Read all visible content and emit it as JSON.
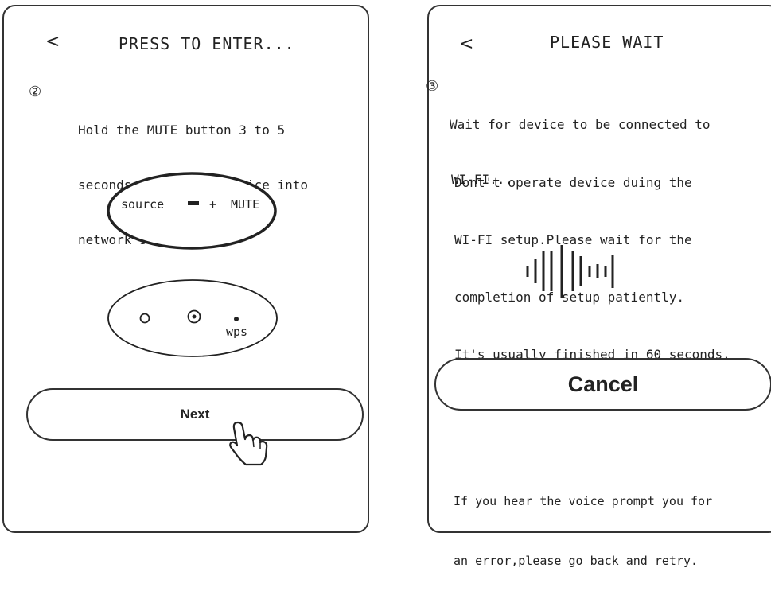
{
  "left_screen": {
    "back_label": "<",
    "title": "PRESS TO ENTER...",
    "step_number": "②",
    "step_lines": [
      "Hold the MUTE button 3 to 5",
      "seconds to put the device into",
      "network setup mode."
    ],
    "remote": {
      "source_label": "source",
      "plus_label": "+",
      "mute_label": "MUTE"
    },
    "device": {
      "wps_label": "wps"
    },
    "next_label": "Next"
  },
  "right_screen": {
    "back_label": "<",
    "title": "PLEASE  WAIT",
    "step_number": "③",
    "step_lines": [
      "Wait for device to be connected to",
      "WI-FI..."
    ],
    "info_lines": [
      "Dont't operate device duing the",
      "WI-FI setup.Please wait for the",
      "completion of setup patiently.",
      "It's usually finished in 60 seconds."
    ],
    "cancel_label": "Cancel",
    "footer_lines": [
      "If you hear the voice prompt you for",
      "an error,please go back and retry."
    ]
  },
  "icons": [
    "back-arrow-icon",
    "remote-button-icon",
    "led-indicator-icon",
    "hand-pointer-icon",
    "sound-wave-icon"
  ]
}
